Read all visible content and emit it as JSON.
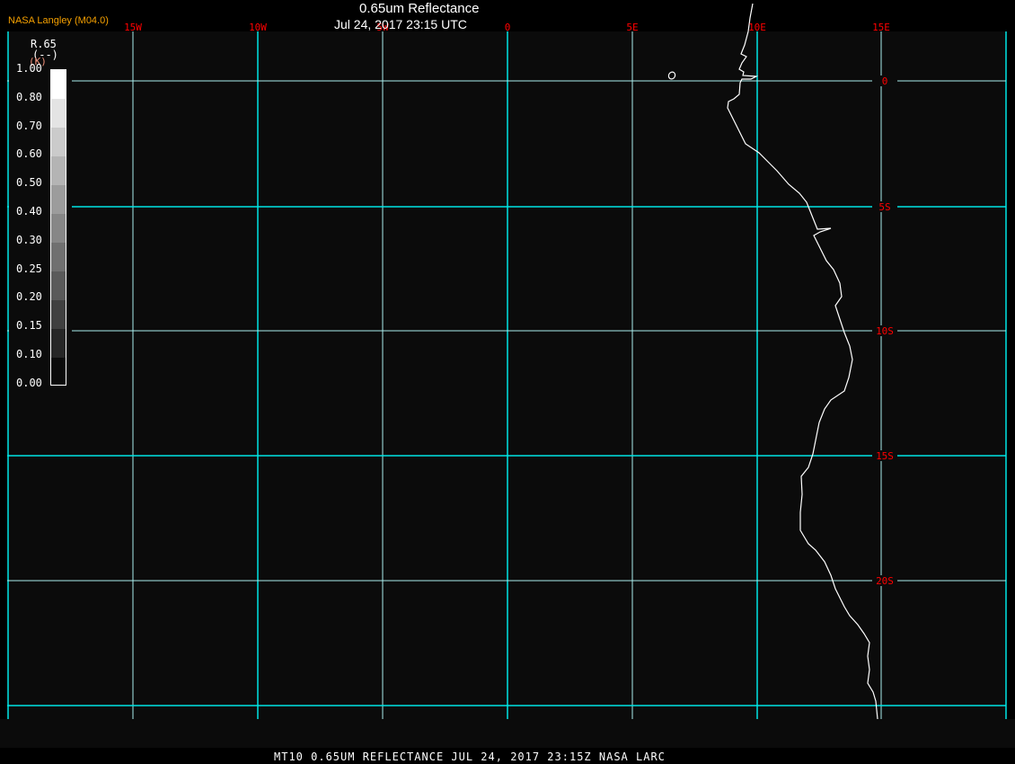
{
  "header": {
    "title": "0.65um Reflectance",
    "datetime": "Jul 24, 2017 23:15 UTC",
    "credit": "NASA Langley (M04.0)"
  },
  "footer": {
    "text": "MT10  0.65UM REFLECTANCE   JUL 24, 2017 23:15Z   NASA LARC"
  },
  "legend": {
    "title": "R.65",
    "units": "(--)",
    "alt_units": "(K)",
    "labels": [
      "1.00",
      "0.80",
      "0.70",
      "0.60",
      "0.50",
      "0.40",
      "0.30",
      "0.25",
      "0.20",
      "0.15",
      "0.10",
      "0.00"
    ],
    "colors": [
      "#ffffff",
      "#e4e4e4",
      "#cbcbcb",
      "#b4b4b4",
      "#9c9c9c",
      "#878787",
      "#707070",
      "#5a5a5a",
      "#404040",
      "#262626",
      "#0b0b0b"
    ]
  },
  "map": {
    "longitude_labels": [
      "15W",
      "10W",
      "5W",
      "0",
      "5E",
      "10E",
      "15E"
    ],
    "latitude_labels": [
      "0",
      "5S",
      "10S",
      "15S",
      "20S"
    ],
    "colors": {
      "grid": "#00e5e5",
      "coastline": "#ffffff",
      "labels": "#ff0000",
      "background": "#0b0b0b"
    }
  }
}
